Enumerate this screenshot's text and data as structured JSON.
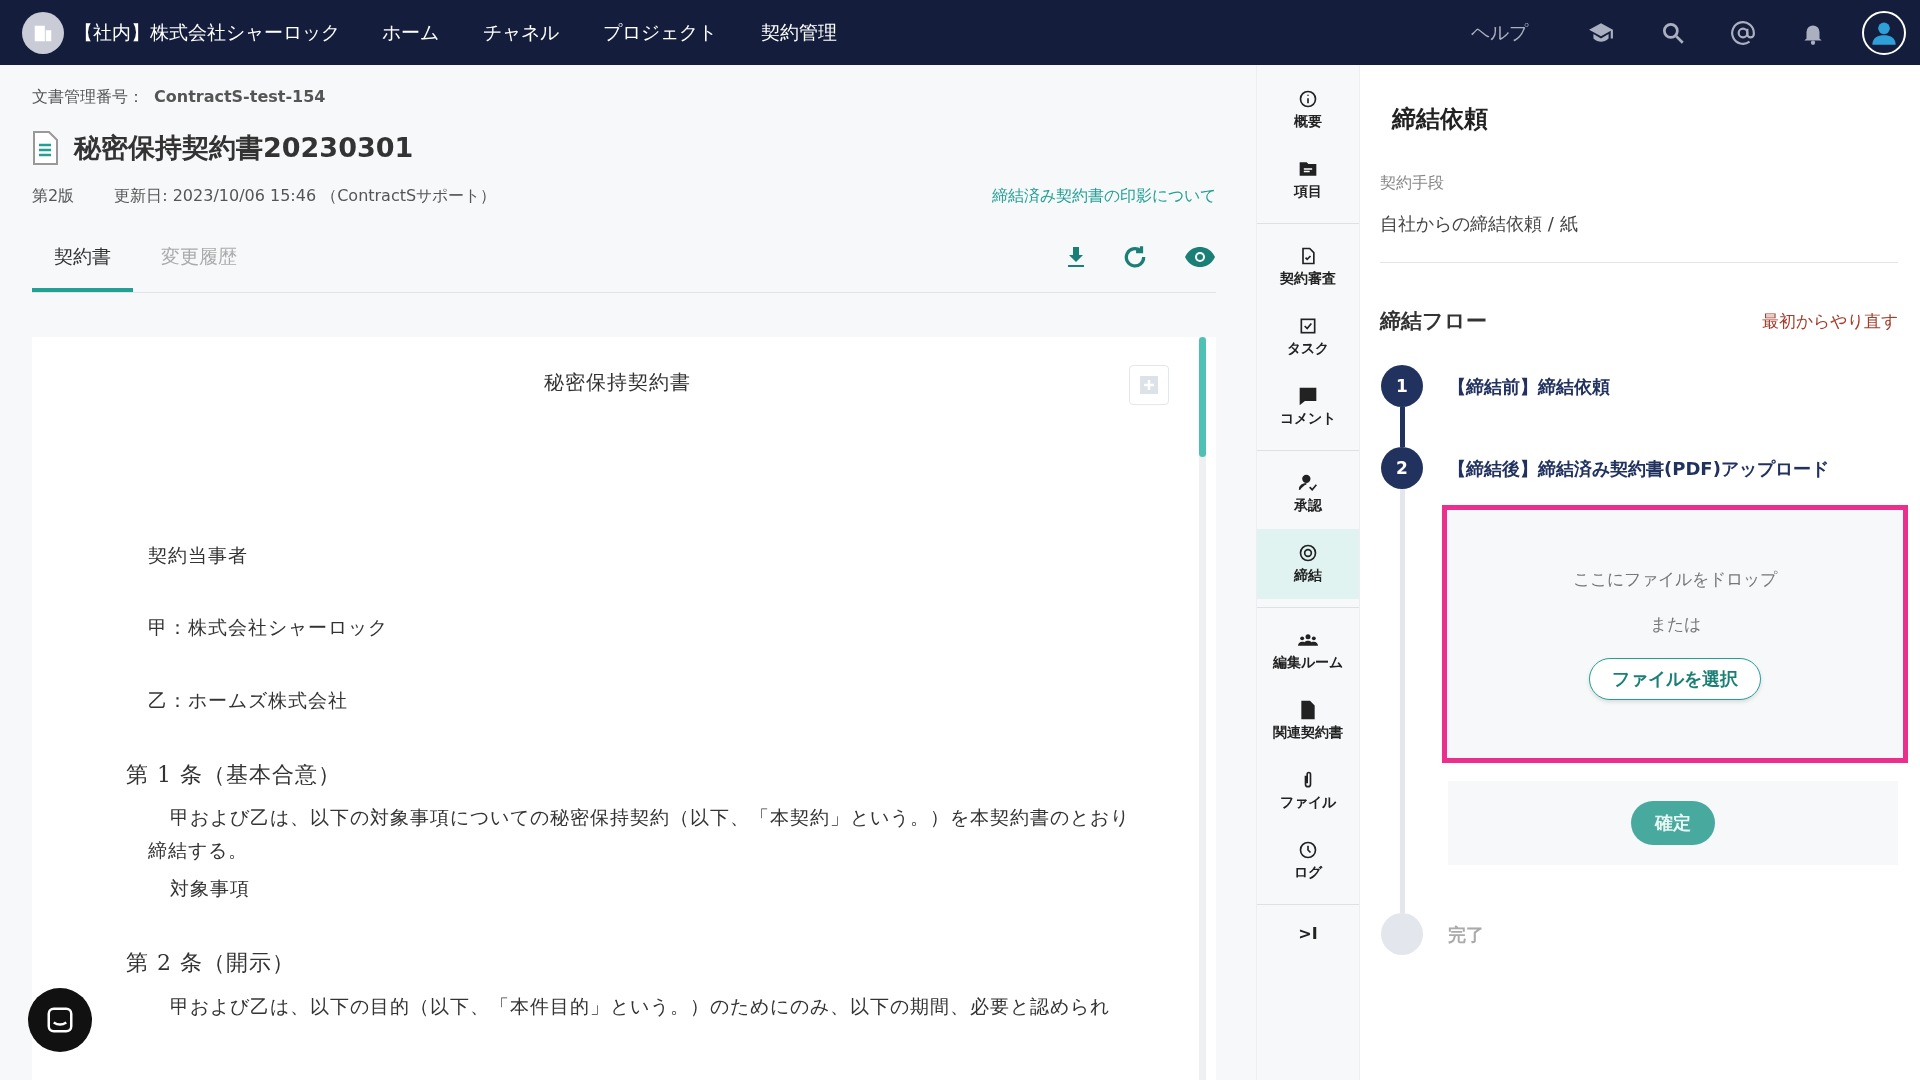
{
  "topbar": {
    "org": "【社内】株式会社シャーロック",
    "nav": [
      "ホーム",
      "チャネル",
      "プロジェクト",
      "契約管理"
    ],
    "help": "ヘルプ"
  },
  "document": {
    "number_label": "文書管理番号：",
    "number": "ContractS-test-154",
    "title": "秘密保持契約書20230301",
    "version": "第2版",
    "updated": "更新日: 2023/10/06 15:46 （ContractSサポート）",
    "seal_link": "締結済み契約書の印影について",
    "tabs": [
      {
        "label": "契約書",
        "selected": true
      },
      {
        "label": "変更履歴",
        "selected": false
      }
    ],
    "blocks": [
      {
        "kind": "title",
        "text": "秘密保持契約書"
      },
      {
        "kind": "party",
        "text": "契約当事者"
      },
      {
        "kind": "party",
        "text": "甲：株式会社シャーロック"
      },
      {
        "kind": "party",
        "text": "乙：ホームズ株式会社"
      },
      {
        "kind": "heading",
        "text": "第 1 条（基本合意）"
      },
      {
        "kind": "paragraph",
        "text": "甲および乙は、以下の対象事項についての秘密保持契約（以下、「本契約」という。）を本契約書のとおり締結する。"
      },
      {
        "kind": "item",
        "text": "対象事項"
      },
      {
        "kind": "heading",
        "text": "第 2 条（開示）"
      },
      {
        "kind": "paragraph",
        "text": "甲および乙は、以下の目的（以下、「本件目的」という。）のためにのみ、以下の期間、必要と認められ"
      }
    ]
  },
  "sidebar": {
    "groups": [
      [
        {
          "kind": "info",
          "label": "概要",
          "selected": false
        },
        {
          "kind": "folder",
          "label": "項目",
          "selected": false
        }
      ],
      [
        {
          "kind": "doccheck",
          "label": "契約審査",
          "selected": false
        },
        {
          "kind": "checkbox",
          "label": "タスク",
          "selected": false
        },
        {
          "kind": "comment",
          "label": "コメント",
          "selected": false
        }
      ],
      [
        {
          "kind": "approve",
          "label": "承認",
          "selected": false
        },
        {
          "kind": "target",
          "label": "締結",
          "selected": true
        }
      ],
      [
        {
          "kind": "people",
          "label": "編集ルーム",
          "selected": false
        },
        {
          "kind": "file",
          "label": "関連契約書",
          "selected": false
        },
        {
          "kind": "clip",
          "label": "ファイル",
          "selected": false
        },
        {
          "kind": "clock",
          "label": "ログ",
          "selected": false
        }
      ]
    ],
    "collapse": ">I"
  },
  "panel": {
    "title": "締結依頼",
    "method_label": "契約手段",
    "method": "自社からの締結依頼 / 紙",
    "flow_title": "締結フロー",
    "restart": "最初からやり直す",
    "steps": [
      {
        "number": "1",
        "label": "【締結前】締結依頼",
        "completed": true,
        "current": false
      },
      {
        "number": "2",
        "label": "【締結後】締結済み契約書(PDF)アップロード",
        "completed": false,
        "current": true
      },
      {
        "label": "完了",
        "completed": false,
        "current": false
      }
    ],
    "dropzone": {
      "hint": "ここにファイルをドロップ",
      "or": "または",
      "button": "ファイルを選択"
    },
    "confirm": "確定"
  }
}
